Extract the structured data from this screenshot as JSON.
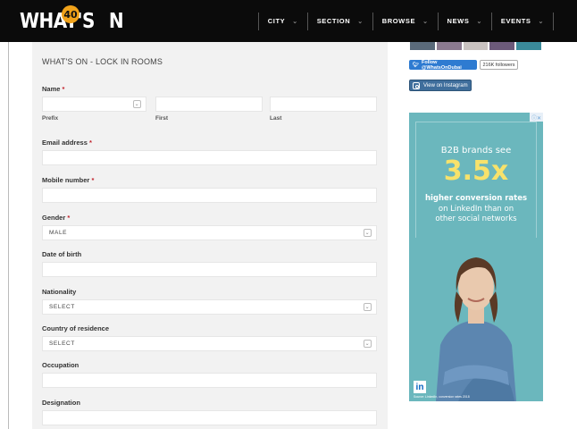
{
  "brand": {
    "logo_text": "WHAT'S",
    "logo_badge": "40",
    "logo_suffix": "N"
  },
  "nav": {
    "items": [
      {
        "label": "CITY",
        "chevron": "⌄"
      },
      {
        "label": "SECTION",
        "chevron": "⌄"
      },
      {
        "label": "BROWSE",
        "chevron": "⌄"
      },
      {
        "label": "NEWS",
        "chevron": "⌄"
      },
      {
        "label": "EVENTS",
        "chevron": "⌄"
      }
    ]
  },
  "form": {
    "title": "WHAT'S ON - LOCK IN ROOMS",
    "name_label": "Name",
    "required_mark": "*",
    "prefix_sub": "Prefix",
    "first_sub": "First",
    "last_sub": "Last",
    "email_label": "Email address",
    "mobile_label": "Mobile number",
    "gender_label": "Gender",
    "gender_value": "MALE",
    "dob_label": "Date of birth",
    "nationality_label": "Nationality",
    "nationality_value": "SELECT",
    "country_label": "Country of residence",
    "country_value": "SELECT",
    "occupation_label": "Occupation",
    "designation_label": "Designation"
  },
  "sidebar": {
    "twitter_label": "Follow @WhatsOnDubai",
    "twitter_followers": "216K followers",
    "instagram_label": "View on Instagram"
  },
  "ad": {
    "close_icon": "ⓘ✕",
    "line1": "B2B brands see",
    "big": "3.5x",
    "line2": "higher conversion rates",
    "line3a": "on LinkedIn than on",
    "line3b": "other social networks",
    "logo": "in",
    "fine_print": "Source: LinkedIn, conversion rates 2018"
  },
  "colors": {
    "nav_bg": "#0b0b0b",
    "accent_orange": "#f0a21a",
    "required_red": "#c0202a",
    "twitter_blue": "#2e7bd1",
    "instagram_blue": "#3f6e9c",
    "ad_bg": "#6bb7bd",
    "ad_highlight": "#f7e26b"
  }
}
